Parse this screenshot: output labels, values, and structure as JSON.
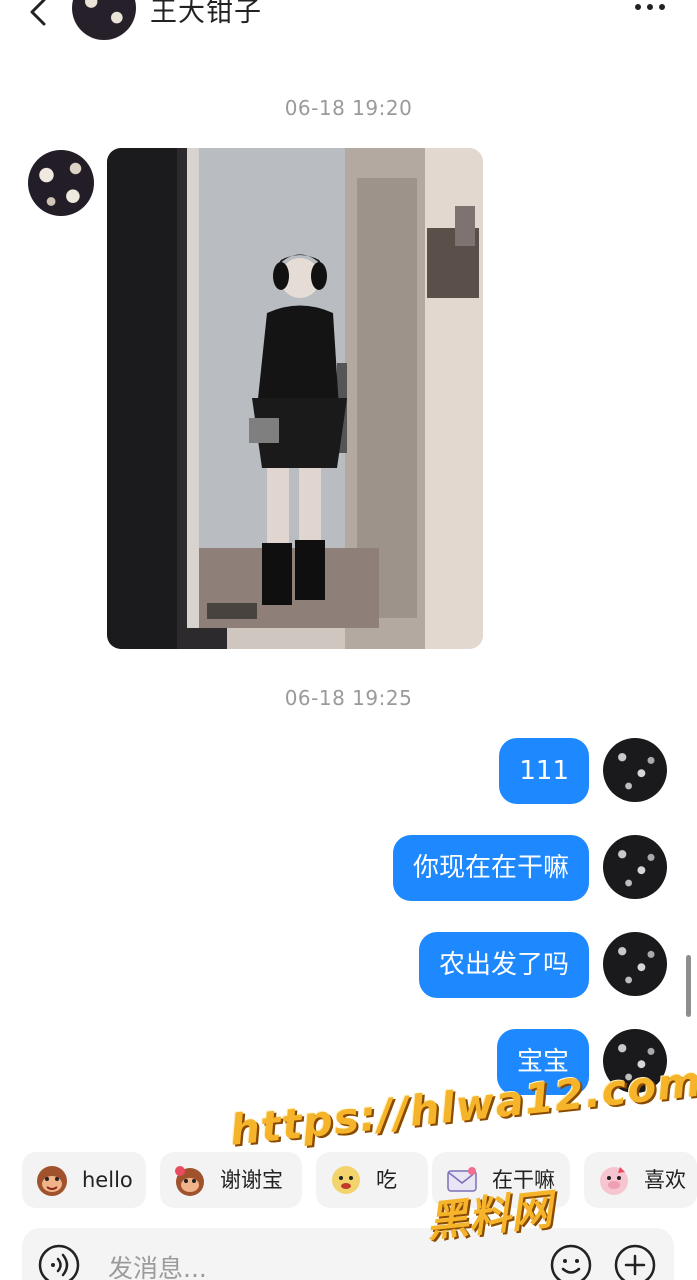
{
  "header": {
    "title": "王大钳子",
    "back_icon": "chevron-left-icon",
    "more_icon": "more-dots-icon"
  },
  "timestamps": [
    "06-18 19:20",
    "06-18 19:25"
  ],
  "outgoing_messages": [
    "111",
    "你现在在干嘛",
    "农出发了吗",
    "宝宝"
  ],
  "quick_replies": [
    {
      "icon": "monkey-emoji-icon",
      "label": "hello"
    },
    {
      "icon": "flower-monkey-emoji-icon",
      "label": "谢谢宝"
    },
    {
      "icon": "sticker-emoji-icon",
      "label": "吃"
    },
    {
      "icon": "envelope-emoji-icon",
      "label": "在干嘛"
    },
    {
      "icon": "pig-emoji-icon",
      "label": "喜欢"
    }
  ],
  "input": {
    "placeholder": "发消息..."
  },
  "watermark": {
    "url": "https://hlwa12.com",
    "text": "黑料网"
  },
  "colors": {
    "bubble": "#1e88ff",
    "timestamp": "#9a9a9a",
    "watermark": "#f5b42a"
  }
}
